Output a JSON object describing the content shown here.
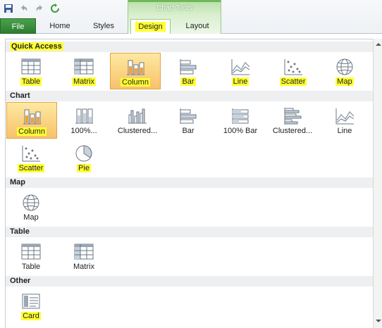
{
  "window": {
    "context_tab_group": "Chart Tools"
  },
  "ribbon": {
    "file_label": "File",
    "tabs": [
      "Home",
      "Styles",
      "Design",
      "Layout"
    ],
    "active_tab": "Design"
  },
  "sections": {
    "quick_access": {
      "title": "Quick Access",
      "items": [
        "Table",
        "Matrix",
        "Column",
        "Bar",
        "Line",
        "Scatter",
        "Map"
      ]
    },
    "chart": {
      "title": "Chart",
      "items": [
        "Column",
        "100%...",
        "Clustered...",
        "Bar",
        "100% Bar",
        "Clustered...",
        "Line",
        "Scatter",
        "Pie"
      ]
    },
    "map": {
      "title": "Map",
      "items": [
        "Map"
      ]
    },
    "table": {
      "title": "Table",
      "items": [
        "Table",
        "Matrix"
      ]
    },
    "other": {
      "title": "Other",
      "items": [
        "Card"
      ]
    }
  },
  "colors": {
    "highlight": "#ffff33",
    "selected_fill": "#f8c16a",
    "context_green": "#6fb85a",
    "file_tab": "#2e7d32"
  }
}
